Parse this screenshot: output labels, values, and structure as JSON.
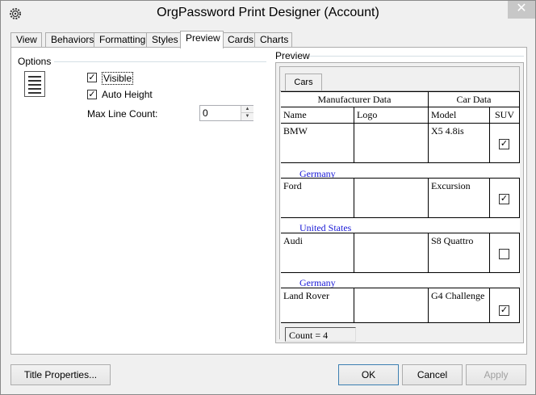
{
  "window": {
    "title": "OrgPassword Print Designer (Account)",
    "close_glyph": "✕"
  },
  "tabs": [
    {
      "label": "View"
    },
    {
      "label": "Behaviors"
    },
    {
      "label": "Formatting"
    },
    {
      "label": "Styles"
    },
    {
      "label": "Preview"
    },
    {
      "label": "Cards"
    },
    {
      "label": "Charts"
    }
  ],
  "active_tab": "Preview",
  "options": {
    "group_label": "Options",
    "visible": {
      "label": "Visible",
      "checked": true
    },
    "auto_height": {
      "label": "Auto Height",
      "checked": true
    },
    "max_line_count": {
      "label": "Max Line Count:",
      "value": "0"
    }
  },
  "preview": {
    "group_label": "Preview",
    "sheet_tab": "Cars",
    "band_headers": {
      "manufacturer": "Manufacturer Data",
      "car": "Car Data"
    },
    "columns": {
      "name": "Name",
      "logo": "Logo",
      "model": "Model",
      "suv": "SUV"
    },
    "rows": [
      {
        "name": "BMW",
        "model": "X5 4.8is",
        "suv": true,
        "country": "Germany"
      },
      {
        "name": "Ford",
        "model": "Excursion",
        "suv": true,
        "country": "United States"
      },
      {
        "name": "Audi",
        "model": "S8 Quattro",
        "suv": false,
        "country": "Germany"
      },
      {
        "name": "Land Rover",
        "model": "G4 Challenge",
        "suv": true
      }
    ],
    "count_label": "Count = 4"
  },
  "buttons": {
    "title_properties": "Title Properties...",
    "ok": "OK",
    "cancel": "Cancel",
    "apply": "Apply"
  }
}
